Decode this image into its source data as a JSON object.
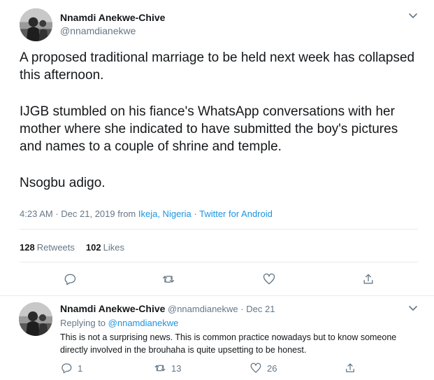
{
  "main_tweet": {
    "author_name": "Nnamdi Anekwe-Chive",
    "author_handle": "@nnamdianekwe",
    "paragraphs": [
      "A proposed traditional marriage to be held next week has collapsed this afternoon.",
      "IJGB stumbled on his fiance's WhatsApp conversations with her mother where she indicated to have submitted the boy's pictures and names to a couple of shrine and temple.",
      "Nsogbu adigo."
    ],
    "time": "4:23 AM",
    "date": "Dec 21, 2019",
    "from_label": "from",
    "location": "Ikeja, Nigeria",
    "source": "Twitter for Android",
    "retweets_count": "128",
    "retweets_label": "Retweets",
    "likes_count": "102",
    "likes_label": "Likes"
  },
  "reply_tweet": {
    "author_name": "Nnamdi Anekwe-Chive",
    "author_handle": "@nnamdianekwe",
    "date": "Dec 21",
    "replying_label": "Replying to",
    "replying_to": "@nnamdianekwe",
    "text": "This is not a surprising news. This is common practice nowadays but to know someone directly involved in the brouhaha is quite upsetting to be honest.",
    "reply_count": "1",
    "retweet_count": "13",
    "like_count": "26"
  },
  "colors": {
    "text": "#14171a",
    "secondary": "#657786",
    "link": "#1b95e0",
    "divider": "#e6ecf0"
  },
  "icons": [
    "avatar-photo",
    "chevron-down-icon",
    "reply-icon",
    "retweet-icon",
    "like-icon",
    "share-icon"
  ]
}
